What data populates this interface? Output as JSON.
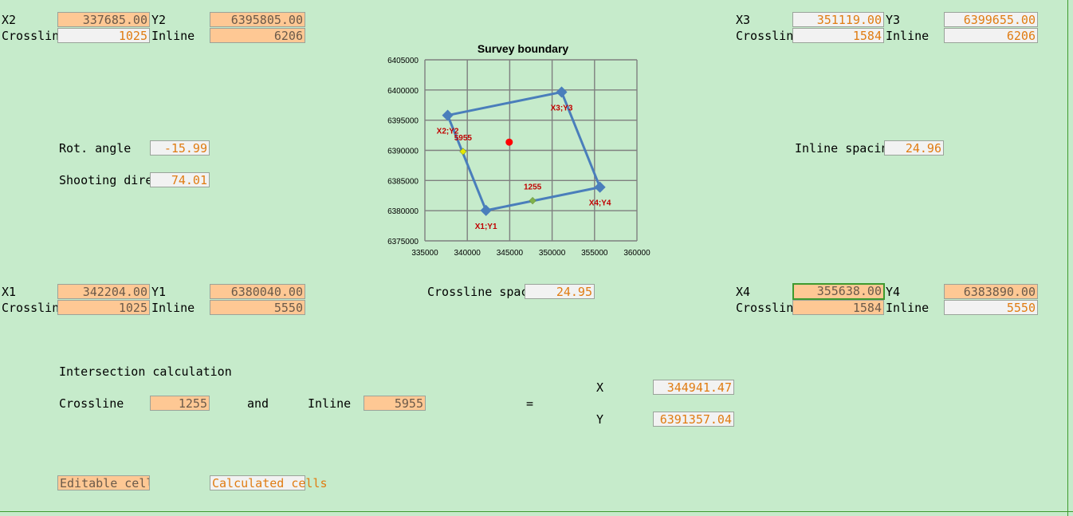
{
  "corners": {
    "c2": {
      "x_label": "X2",
      "x_value": "337685.00",
      "y_label": "Y2",
      "y_value": "6395805.00",
      "cross_label": "Crossline",
      "cross_value": "1025",
      "inline_label": "Inline",
      "inline_value": "6206"
    },
    "c3": {
      "x_label": "X3",
      "x_value": "351119.00",
      "y_label": "Y3",
      "y_value": "6399655.00",
      "cross_label": "Crossline",
      "cross_value": "1584",
      "inline_label": "Inline",
      "inline_value": "6206"
    },
    "c1": {
      "x_label": "X1",
      "x_value": "342204.00",
      "y_label": "Y1",
      "y_value": "6380040.00",
      "cross_label": "Crossline",
      "cross_value": "1025",
      "inline_label": "Inline",
      "inline_value": "5550"
    },
    "c4": {
      "x_label": "X4",
      "x_value": "355638.00",
      "y_label": "Y4",
      "y_value": "6383890.00",
      "cross_label": "Crossline",
      "cross_value": "1584",
      "inline_label": "Inline",
      "inline_value": "5550"
    }
  },
  "params": {
    "rot_label": "Rot. angle",
    "rot_value": "-15.99",
    "shoot_label": "Shooting direction",
    "shoot_value": "74.01",
    "inline_spacing_label": "Inline spacing",
    "inline_spacing_value": "24.96",
    "crossline_spacing_label": "Crossline spacing",
    "crossline_spacing_value": "24.95"
  },
  "intersection": {
    "title": "Intersection calculation",
    "crossline_label": "Crossline",
    "crossline_value": "1255",
    "and_label": "and",
    "inline_label": "Inline",
    "inline_value": "5955",
    "equals": "=",
    "x_label": "X",
    "x_value": "344941.47",
    "y_label": "Y",
    "y_value": "6391357.04"
  },
  "legend": {
    "editable": "Editable cells",
    "calculated": "Calculated cells"
  },
  "colors": {
    "editable_fill": "#fec894",
    "calculated_fill": "#f2f2f2",
    "calculated_text": "#e07c12",
    "background": "#c6ebcb",
    "series": "#4a7ebb",
    "point_label": "#c00000",
    "intersection_point": "#ff0000"
  },
  "chart_data": {
    "type": "scatter",
    "title": "Survey boundary",
    "xlim": [
      335000,
      360000
    ],
    "ylim": [
      6375000,
      6405000
    ],
    "xticks": [
      "335000",
      "340000",
      "345000",
      "350000",
      "355000",
      "360000"
    ],
    "yticks": [
      "6375000",
      "6380000",
      "6385000",
      "6390000",
      "6395000",
      "6400000",
      "6405000"
    ],
    "grid": true,
    "series": [
      {
        "points": [
          {
            "x": 342204,
            "y": 6380040,
            "label": "X1;Y1"
          },
          {
            "x": 355638,
            "y": 6383890,
            "label": "X4;Y4"
          },
          {
            "x": 351119,
            "y": 6399655,
            "label": "X3;Y3"
          },
          {
            "x": 337685,
            "y": 6395805,
            "label": "X2;Y2"
          },
          {
            "x": 342204,
            "y": 6380040,
            "label": ""
          }
        ]
      }
    ],
    "markers": [
      {
        "x": 347700,
        "y": 6381660,
        "label": "1255",
        "color": "#7fb24a"
      },
      {
        "x": 339500,
        "y": 6389800,
        "label": "5955",
        "color": "#e6e600"
      },
      {
        "x": 344941,
        "y": 6391357,
        "label": "",
        "color": "#ff0000"
      }
    ]
  }
}
